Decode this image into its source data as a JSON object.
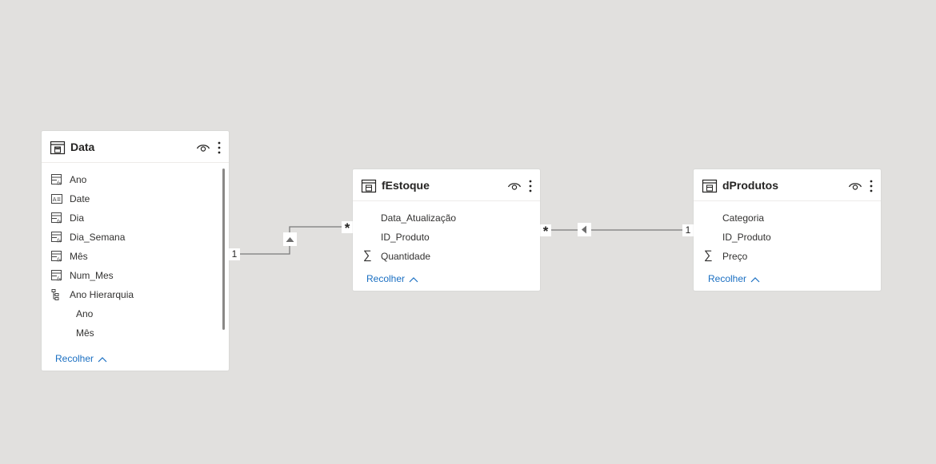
{
  "tables": {
    "data": {
      "title": "Data",
      "fields": [
        "Ano",
        "Date",
        "Dia",
        "Dia_Semana",
        "Mês",
        "Num_Mes"
      ],
      "hierarchy": {
        "name": "Ano Hierarquia",
        "levels": [
          "Ano",
          "Mês"
        ]
      },
      "collapse_label": "Recolher"
    },
    "festoque": {
      "title": "fEstoque",
      "fields": [
        "Data_Atualização",
        "ID_Produto",
        "Quantidade"
      ],
      "collapse_label": "Recolher"
    },
    "dprodutos": {
      "title": "dProdutos",
      "fields": [
        "Categoria",
        "ID_Produto",
        "Preço"
      ],
      "collapse_label": "Recolher"
    }
  },
  "relationships": {
    "data_festoque": {
      "from_cardinality": "1",
      "to_cardinality": "*"
    },
    "dprodutos_festoque": {
      "from_cardinality": "1",
      "to_cardinality": "*"
    }
  },
  "icons": {
    "table": "table-icon",
    "visibility": "eye-icon",
    "more": "more-options-icon",
    "calculated_column": "calculated-column-icon",
    "date_column": "date-column-icon",
    "hierarchy": "hierarchy-icon",
    "sum": "sigma-icon",
    "cross_filter": "filter-direction-icon"
  },
  "colors": {
    "canvas": "#e1e0de",
    "link": "#6e6e6e",
    "accent": "#1a6fc2"
  }
}
